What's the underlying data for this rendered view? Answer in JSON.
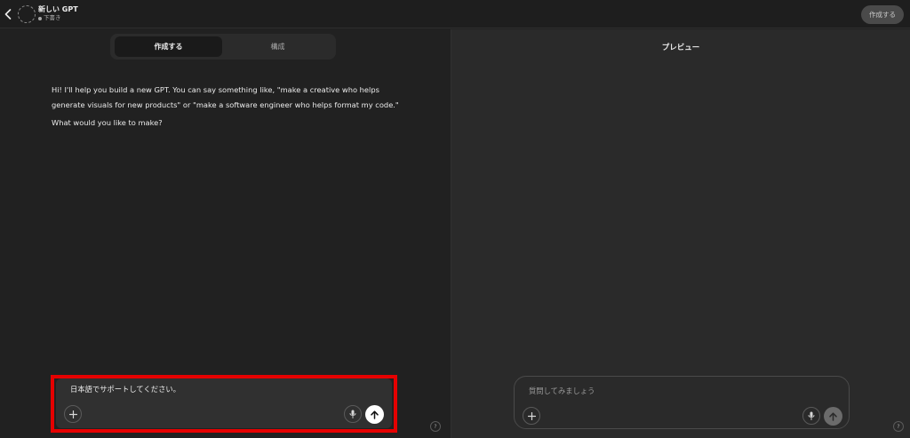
{
  "header": {
    "gpt_name": "新しい GPT",
    "status": "下書き",
    "create_button": "作成する"
  },
  "left": {
    "tabs": [
      {
        "label": "作成する",
        "active": true
      },
      {
        "label": "構成",
        "active": false
      }
    ],
    "message": {
      "paragraph1": "Hi! I'll help you build a new GPT. You can say something like, \"make a creative who helps generate visuals for new products\" or \"make a software engineer who helps format my code.\"",
      "paragraph2": "What would you like to make?"
    },
    "composer": {
      "value": "日本語でサポートしてください。"
    },
    "help": "?"
  },
  "right": {
    "title": "プレビュー",
    "composer": {
      "placeholder": "質問してみましょう"
    },
    "help": "?"
  },
  "colors": {
    "highlight": "#e60000",
    "background": "#212121",
    "preview_background": "#2a2a2a"
  }
}
